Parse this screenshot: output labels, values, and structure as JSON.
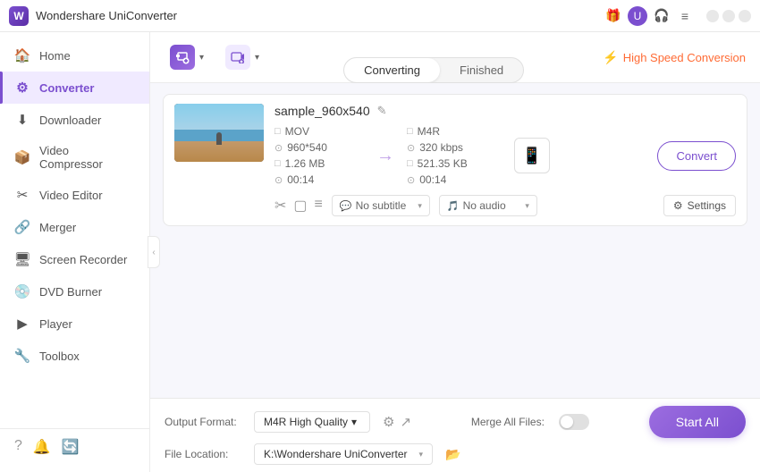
{
  "titleBar": {
    "appName": "Wondershare UniConverter",
    "tbIcons": [
      "🎁",
      "👤",
      "🎧",
      "≡"
    ],
    "winBtns": [
      "−",
      "□",
      "✕"
    ]
  },
  "sidebar": {
    "items": [
      {
        "id": "home",
        "label": "Home",
        "icon": "🏠",
        "active": false
      },
      {
        "id": "converter",
        "label": "Converter",
        "icon": "⚙",
        "active": true
      },
      {
        "id": "downloader",
        "label": "Downloader",
        "icon": "⬇",
        "active": false
      },
      {
        "id": "video-compressor",
        "label": "Video Compressor",
        "icon": "📦",
        "active": false
      },
      {
        "id": "video-editor",
        "label": "Video Editor",
        "icon": "✂",
        "active": false
      },
      {
        "id": "merger",
        "label": "Merger",
        "icon": "🔗",
        "active": false
      },
      {
        "id": "screen-recorder",
        "label": "Screen Recorder",
        "icon": "🖥",
        "active": false
      },
      {
        "id": "dvd-burner",
        "label": "DVD Burner",
        "icon": "💿",
        "active": false
      },
      {
        "id": "player",
        "label": "Player",
        "icon": "▶",
        "active": false
      },
      {
        "id": "toolbox",
        "label": "Toolbox",
        "icon": "🔧",
        "active": false
      }
    ],
    "bottomIcons": [
      "?",
      "🔔",
      "🔄"
    ]
  },
  "toolbar": {
    "addBtn": {
      "icon": "📁",
      "label": ""
    },
    "camBtn": {
      "icon": "🎬",
      "label": ""
    },
    "chevron": "▾"
  },
  "tabs": {
    "converting": "Converting",
    "finished": "Finished",
    "activeTab": "converting"
  },
  "highSpeed": {
    "bolt": "⚡",
    "label": "High Speed Conversion"
  },
  "fileCard": {
    "fileName": "sample_960x540",
    "editIcon": "✎",
    "source": {
      "format": "MOV",
      "resolution": "960*540",
      "size": "1.26 MB",
      "duration": "00:14"
    },
    "output": {
      "format": "M4R",
      "bitrate": "320 kbps",
      "size": "521.35 KB",
      "duration": "00:14"
    },
    "subtitlePlaceholder": "No subtitle",
    "audioLabel": "No audio",
    "settingsLabel": "Settings",
    "convertLabel": "Convert"
  },
  "bottomBar": {
    "outputFormatLabel": "Output Format:",
    "outputFormatValue": "M4R High Quality",
    "fileLocationLabel": "File Location:",
    "fileLocationValue": "K:\\Wondershare UniConverter",
    "mergeLabel": "Merge All Files:",
    "startAllLabel": "Start All"
  }
}
